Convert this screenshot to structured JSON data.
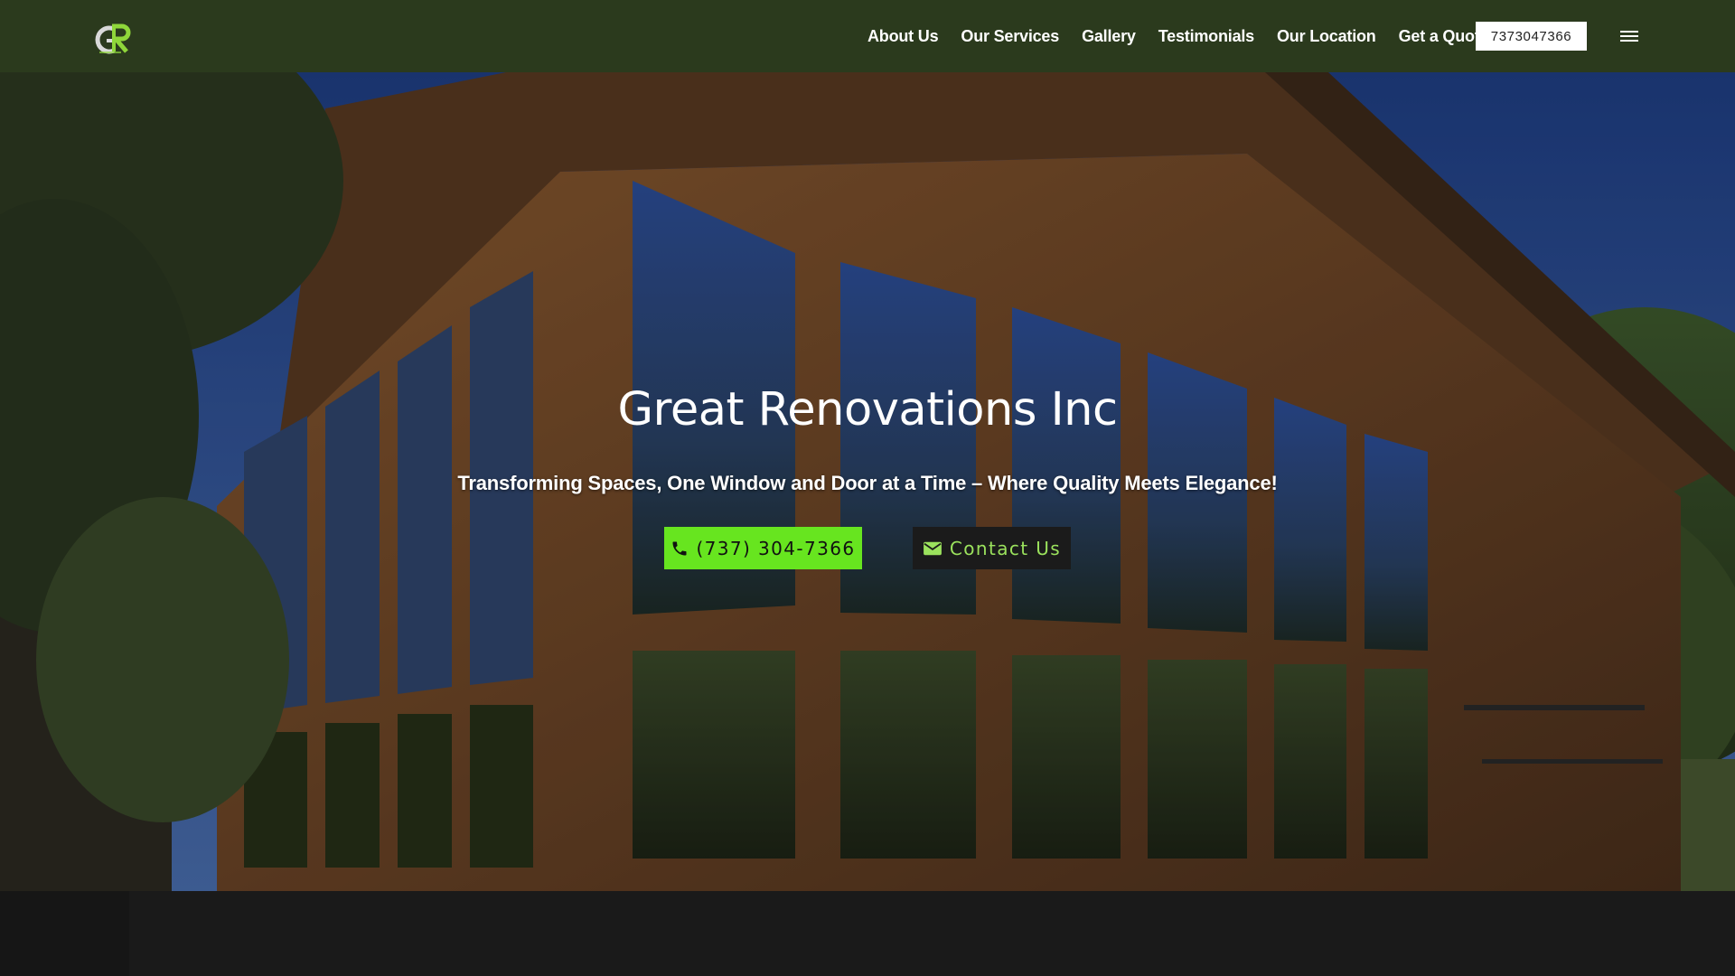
{
  "header": {
    "logo_icon": "gr-monogram-logo",
    "nav": [
      {
        "label": "About Us"
      },
      {
        "label": "Our Services"
      },
      {
        "label": "Gallery"
      },
      {
        "label": "Testimonials"
      },
      {
        "label": "Our Location"
      },
      {
        "label": "Get a Quote"
      }
    ],
    "phone_label": "7373047366",
    "menu_icon": "hamburger-menu-icon"
  },
  "hero": {
    "title": "Great Renovations Inc",
    "subtitle": "Transforming Spaces, One Window and Door at a Time – Where Quality Meets Elegance!",
    "call_button": {
      "label": "(737) 304-7366",
      "icon": "phone-icon"
    },
    "contact_button": {
      "label": "Contact Us",
      "icon": "envelope-icon"
    },
    "background": "wooden-house-with-large-glass-windows-photo"
  },
  "colors": {
    "header_bg": "#2b3a1d",
    "accent_green": "#67e51f",
    "logo_green": "#8fd63a",
    "page_bg": "#161616",
    "contact_text": "#9be25d"
  }
}
